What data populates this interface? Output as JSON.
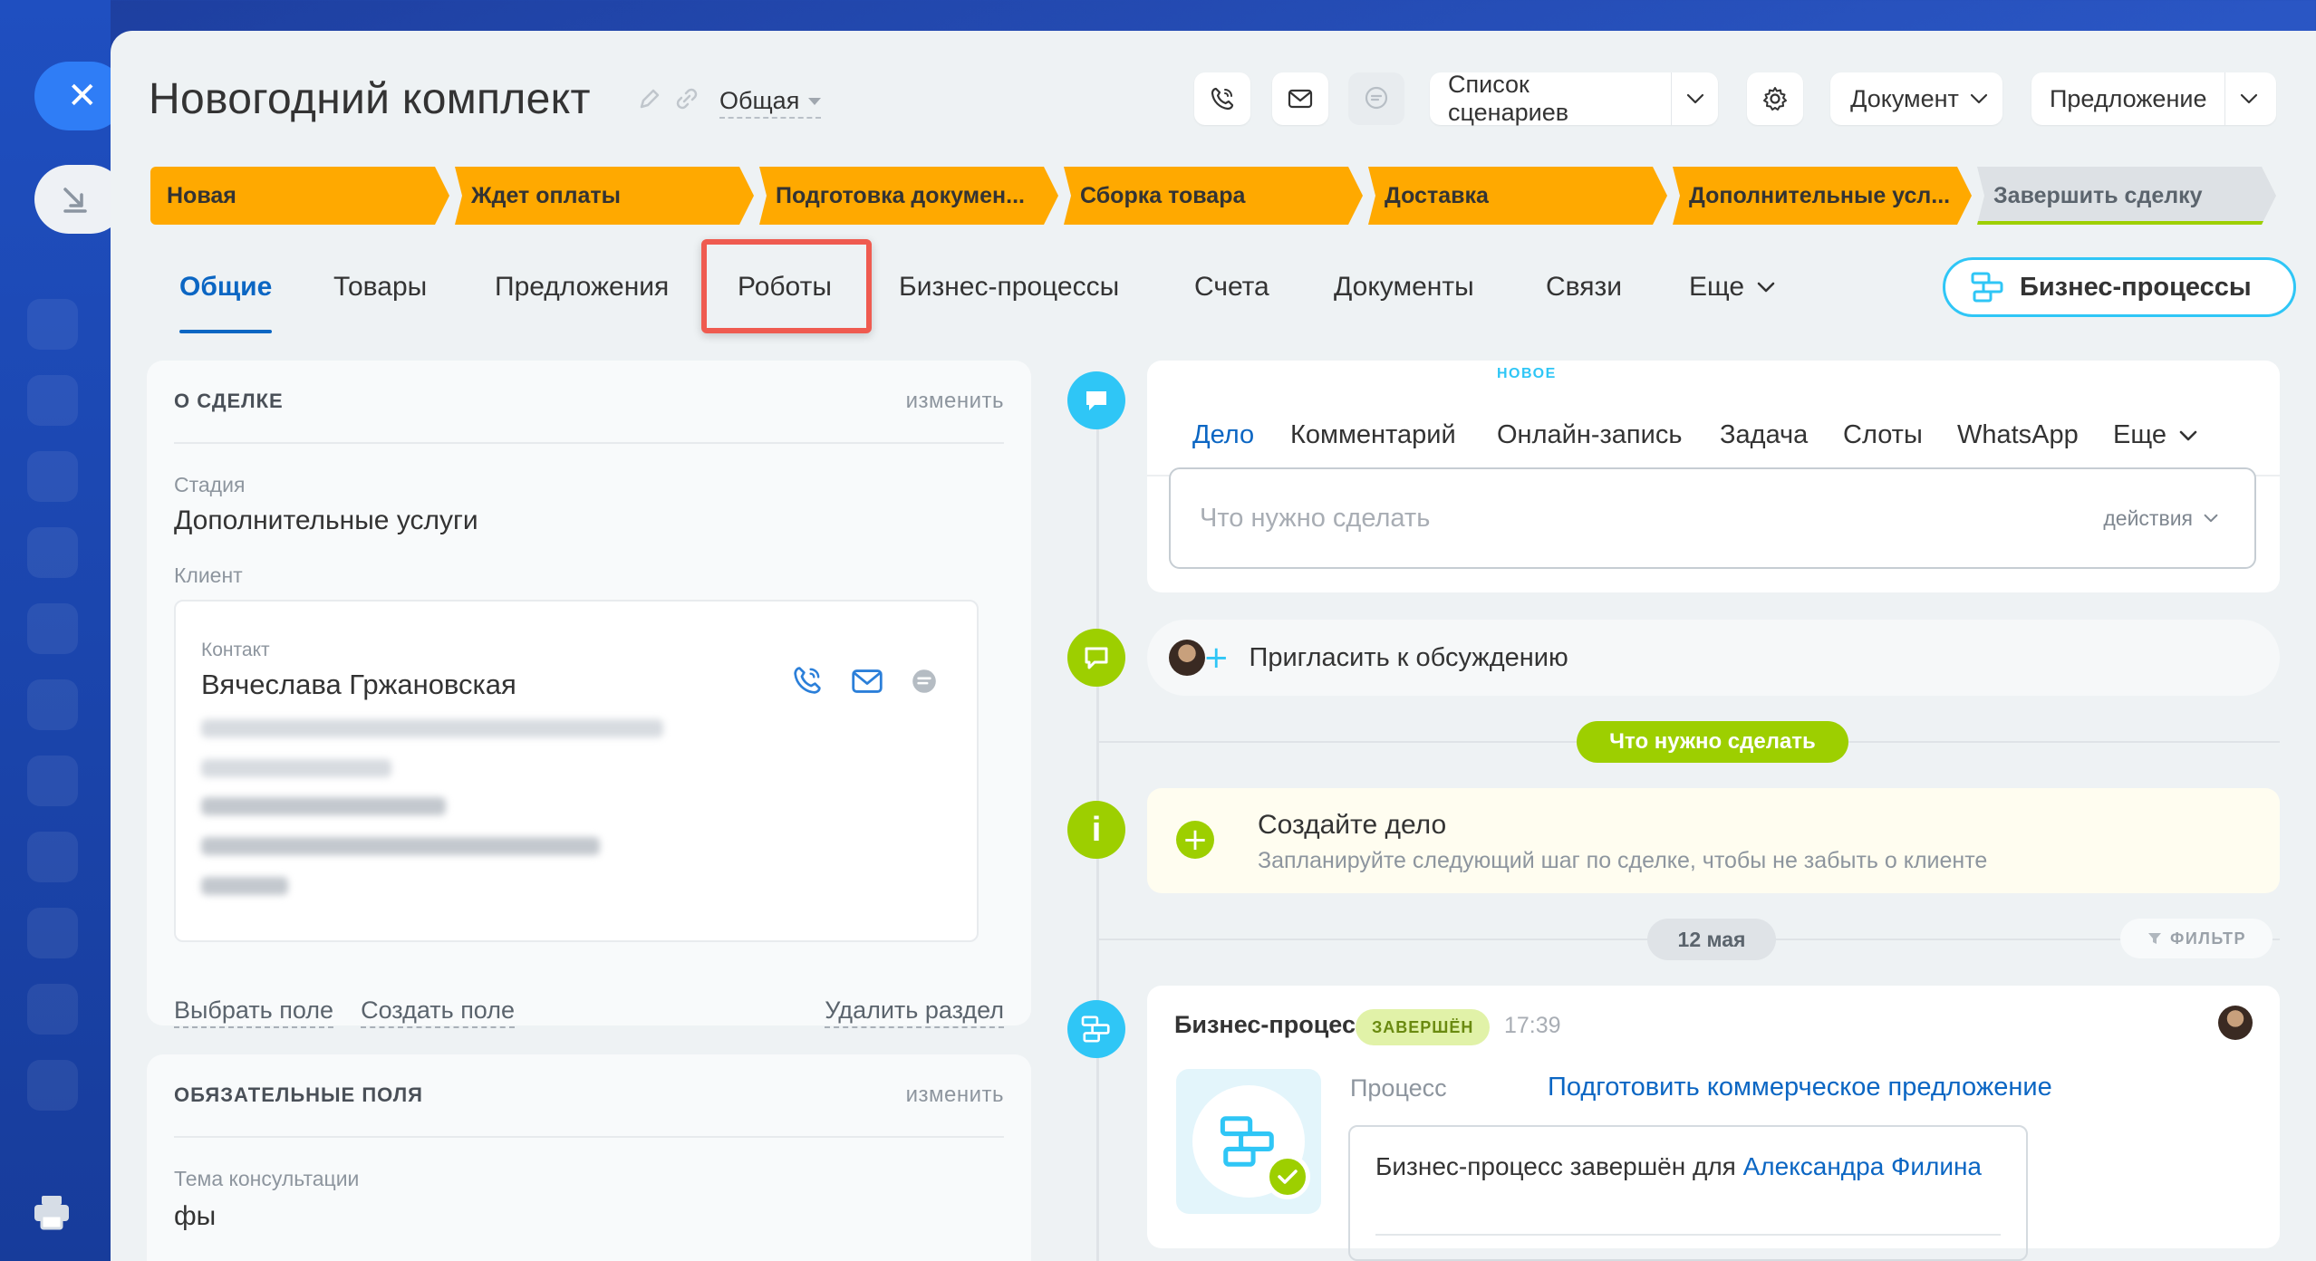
{
  "deal": {
    "title": "Новогодний комплект",
    "category": "Общая"
  },
  "header": {
    "scenarios_label": "Список сценариев",
    "document_label": "Документ",
    "offer_label": "Предложение"
  },
  "stages": [
    {
      "label": "Новая"
    },
    {
      "label": "Ждет оплаты"
    },
    {
      "label": "Подготовка докумен..."
    },
    {
      "label": "Сборка товара"
    },
    {
      "label": "Доставка"
    },
    {
      "label": "Дополнительные усл..."
    },
    {
      "label": "Завершить сделку"
    }
  ],
  "tabs": [
    {
      "label": "Общие",
      "active": true
    },
    {
      "label": "Товары"
    },
    {
      "label": "Предложения"
    },
    {
      "label": "Роботы"
    },
    {
      "label": "Бизнес-процессы"
    },
    {
      "label": "Счета"
    },
    {
      "label": "Документы"
    },
    {
      "label": "Связи"
    },
    {
      "label": "Еще"
    }
  ],
  "bp_button": "Бизнес-процессы",
  "about": {
    "title": "О СДЕЛКЕ",
    "edit": "изменить",
    "stage_label": "Стадия",
    "stage_value": "Дополнительные услуги",
    "client_label": "Клиент",
    "contact_label": "Контакт",
    "contact_name": "Вячеслава Гржановская",
    "select_field": "Выбрать поле",
    "create_field": "Создать поле",
    "delete_section": "Удалить раздел"
  },
  "required": {
    "title": "ОБЯЗАТЕЛЬНЫЕ ПОЛЯ",
    "edit": "изменить",
    "topic_label": "Тема консультации",
    "topic_value": "фы"
  },
  "editor": {
    "tabs": [
      {
        "label": "Дело",
        "active": true
      },
      {
        "label": "Комментарий"
      },
      {
        "label": "Онлайн-запись"
      },
      {
        "label": "Задача"
      },
      {
        "label": "Слоты"
      },
      {
        "label": "WhatsApp"
      },
      {
        "label": "Еще"
      }
    ],
    "new_badge": "НОВОЕ",
    "placeholder": "Что нужно сделать",
    "actions": "действия"
  },
  "invite": "Пригласить к обсуждению",
  "todo_pill": "Что нужно сделать",
  "create": {
    "title": "Создайте дело",
    "subtitle": "Запланируйте следующий шаг по сделке, чтобы не забыть о клиенте"
  },
  "date_pill": "12 мая",
  "filter": "ФИЛЬТР",
  "bp_event": {
    "title": "Бизнес-процесс",
    "status": "ЗАВЕРШЁН",
    "time": "17:39",
    "process_label": "Процесс",
    "process_link": "Подготовить коммерческое предложение",
    "message": "Бизнес-процесс завершён для",
    "person": "Александра Филина"
  },
  "colors": {
    "stage": "#ffa900",
    "accent": "#0b66c3",
    "success": "#9dcf00",
    "info": "#2fc6f6",
    "highlight": "#ef5b50"
  }
}
